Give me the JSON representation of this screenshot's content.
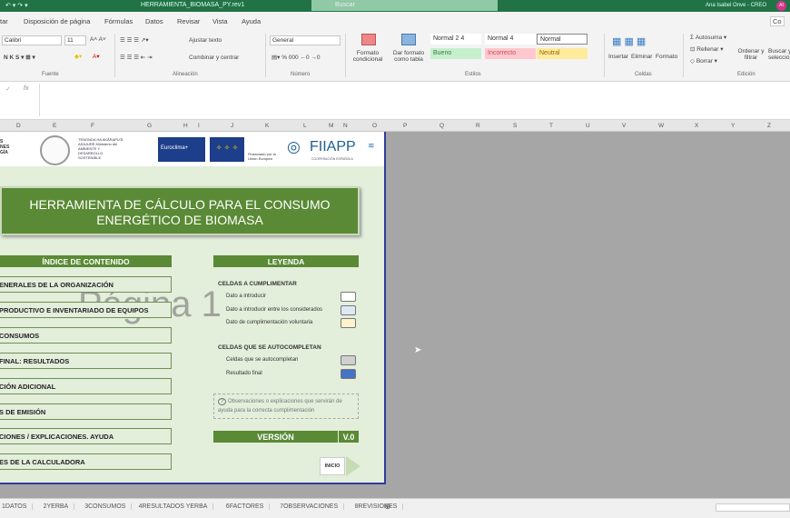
{
  "window": {
    "title": "HERRAMIENTA_BIOMASA_PY.rev1",
    "search_placeholder": "Buscar",
    "user": "Ana Isabel Onve - CREO",
    "avatar": "AI",
    "share": "Co"
  },
  "ribbon_tabs": [
    "tar",
    "Disposición de página",
    "Fórmulas",
    "Datos",
    "Revisar",
    "Vista",
    "Ayuda"
  ],
  "ribbon": {
    "font": "Calibri",
    "size": "11",
    "wrap": "Ajustar texto",
    "merge": "Combinar y centrar",
    "number_format": "General",
    "cond_format": "Formato condicional",
    "table_format": "Dar formato como tabla",
    "styles": [
      {
        "label": "Normal 2 4",
        "bg": "#ffffff",
        "color": "#333"
      },
      {
        "label": "Normal 4",
        "bg": "#ffffff",
        "color": "#333"
      },
      {
        "label": "Normal",
        "bg": "#ffffff",
        "color": "#333"
      },
      {
        "label": "Bueno",
        "bg": "#c6efce",
        "color": "#3a7d44"
      },
      {
        "label": "Incorrecto",
        "bg": "#ffc7ce",
        "color": "#c0504d"
      },
      {
        "label": "Neutral",
        "bg": "#ffeb9c",
        "color": "#9c6500"
      }
    ],
    "insert": "Insertar",
    "delete": "Eliminar",
    "format": "Formato",
    "autosum": "Autosuma",
    "fill": "Rellenar",
    "clear": "Borrar",
    "sort": "Ordenar y filtrar",
    "find": "Buscar y seleccionar",
    "groups": {
      "font": "Fuente",
      "align": "Alineación",
      "number": "Número",
      "styles": "Estilos",
      "cells": "Celdas",
      "editing": "Edición"
    }
  },
  "columns": [
    "D",
    "E",
    "F",
    "G",
    "H",
    "I",
    "J",
    "K",
    "L",
    "M",
    "N",
    "O",
    "P",
    "Q",
    "R",
    "S",
    "T",
    "U",
    "V",
    "W",
    "X",
    "Y",
    "Z"
  ],
  "sheet": {
    "logos": {
      "left_text": "S NES GÍA",
      "tenonda": "TENONDA HA AKÃRAPU'Ã ASAJURÉ Ministerio del AMBIENTE Y DESARROLLO SOSTENIBLE",
      "euroclima": "Euroclima+",
      "eu_caption": "Financiado por la Unión Europea",
      "fiiapp": "FIIAPP",
      "fiiapp_sub": "COOPERACIÓN ESPAÑOLA"
    },
    "title_line1": "HERRAMIENTA DE CÁLCULO PARA EL CONSUMO",
    "title_line2": "ENERGÉTICO DE BIOMASA",
    "index_header": "ÍNDICE DE CONTENIDO",
    "index_items": [
      "ENERALES DE LA ORGANIZACIÓN",
      "PRODUCTIVO E INVENTARIADO DE EQUIPOS",
      "CONSUMOS",
      "FINAL: RESULTADOS",
      "CIÓN ADICIONAL",
      "S DE EMISIÓN",
      "CIONES / EXPLICACIONES. AYUDA",
      "ES DE LA CALCULADORA"
    ],
    "legend_header": "LEYENDA",
    "legend_fill_title": "CELDAS A CUMPLIMENTAR",
    "legend_fill": [
      {
        "label": "Dato a introducir",
        "color": "#ffffff"
      },
      {
        "label": "Dato a introducir entre los considerados",
        "color": "#dce9f5"
      },
      {
        "label": "Dato de cumplimentación voluntaria",
        "color": "#fff2cc"
      }
    ],
    "legend_auto_title": "CELDAS QUE SE AUTOCOMPLETAN",
    "legend_auto": [
      {
        "label": "Celdas que se autocompletan",
        "color": "#d0d0d0"
      },
      {
        "label": "Resultado final",
        "color": "#4472c4"
      }
    ],
    "note": "Observaciones o explicaciones que servirán de ayuda para la correcta cumplimentación",
    "version_label": "VERSIÓN",
    "version": "V.0",
    "start_button": "INICIO",
    "watermark": "Página 1"
  },
  "sheet_tabs": [
    "1DATOS",
    "2YERBA",
    "3CONSUMOS",
    "4RESULTADOS YERBA",
    "6FACTORES",
    "7OBSERVACIONES",
    "8REVISIONES"
  ]
}
